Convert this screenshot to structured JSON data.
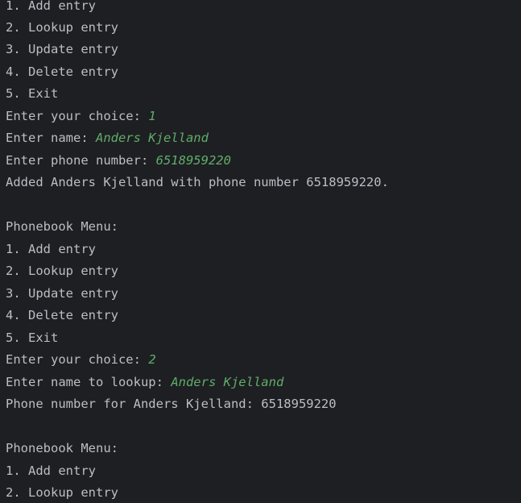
{
  "colors": {
    "background": "#1e1f22",
    "output_text": "#bcbec4",
    "user_input": "#5fad6b"
  },
  "console": {
    "lines": [
      {
        "text": "1. Add entry"
      },
      {
        "text": "2. Lookup entry"
      },
      {
        "text": "3. Update entry"
      },
      {
        "text": "4. Delete entry"
      },
      {
        "text": "5. Exit"
      },
      {
        "text": "Enter your choice: ",
        "input": "1"
      },
      {
        "text": "Enter name: ",
        "input": "Anders Kjelland"
      },
      {
        "text": "Enter phone number: ",
        "input": "6518959220"
      },
      {
        "text": "Added Anders Kjelland with phone number 6518959220."
      },
      {
        "text": ""
      },
      {
        "text": "Phonebook Menu:"
      },
      {
        "text": "1. Add entry"
      },
      {
        "text": "2. Lookup entry"
      },
      {
        "text": "3. Update entry"
      },
      {
        "text": "4. Delete entry"
      },
      {
        "text": "5. Exit"
      },
      {
        "text": "Enter your choice: ",
        "input": "2"
      },
      {
        "text": "Enter name to lookup: ",
        "input": "Anders Kjelland"
      },
      {
        "text": "Phone number for Anders Kjelland: 6518959220"
      },
      {
        "text": ""
      },
      {
        "text": "Phonebook Menu:"
      },
      {
        "text": "1. Add entry"
      },
      {
        "text": "2. Lookup entry"
      }
    ]
  }
}
